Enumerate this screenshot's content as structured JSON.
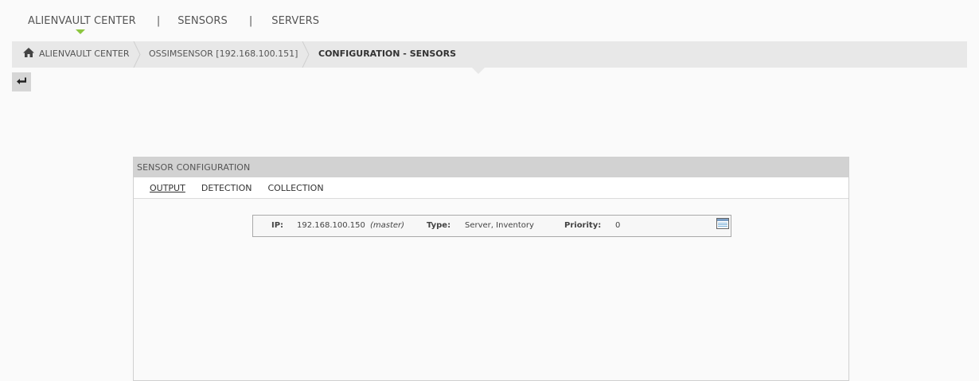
{
  "top_nav": {
    "items": [
      {
        "label": "ALIENVAULT CENTER",
        "active": true
      },
      {
        "label": "SENSORS"
      },
      {
        "label": "SERVERS"
      }
    ],
    "separator": "|",
    "active_color": "#8cc63f"
  },
  "breadcrumb": {
    "items": [
      {
        "label": "ALIENVAULT CENTER",
        "icon": "home-icon"
      },
      {
        "label": "OSSIMSENSOR [192.168.100.151]"
      },
      {
        "label": "CONFIGURATION - SENSORS",
        "current": true
      }
    ]
  },
  "back_button": {
    "icon": "back-arrow-icon"
  },
  "panel": {
    "title": "SENSOR CONFIGURATION",
    "tabs": [
      {
        "label": "OUTPUT",
        "active": true
      },
      {
        "label": "DETECTION"
      },
      {
        "label": "COLLECTION"
      }
    ],
    "server": {
      "ip_label": "IP:",
      "ip": "192.168.100.150",
      "role": "(master)",
      "type_label": "Type:",
      "type": "Server, Inventory",
      "priority_label": "Priority:",
      "priority": "0",
      "detail_icon": "window-icon"
    }
  }
}
